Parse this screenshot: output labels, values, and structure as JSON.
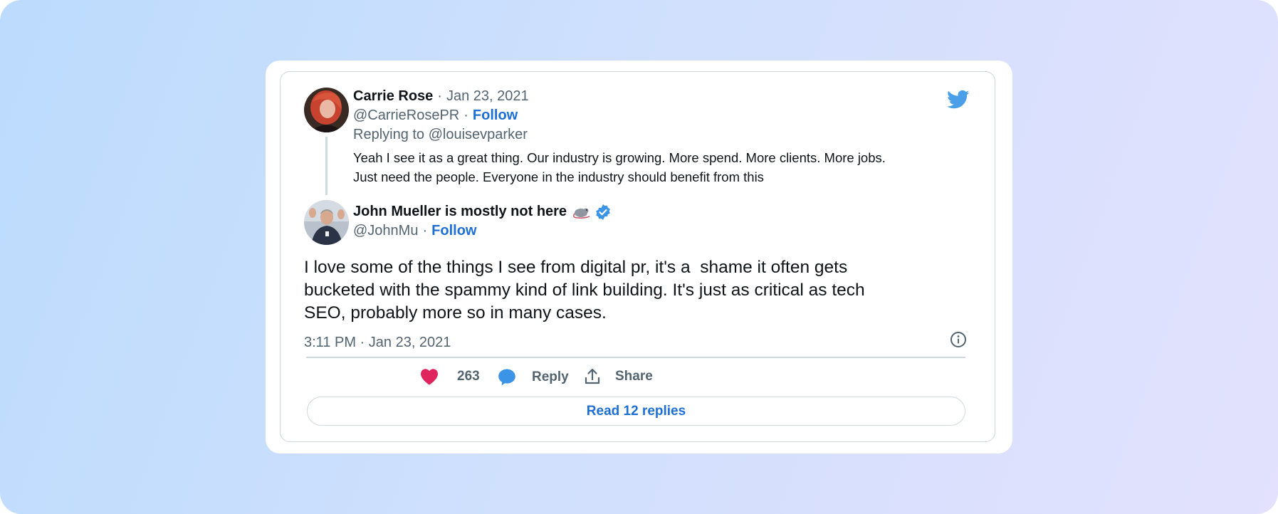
{
  "colors": {
    "accent": "#1d6fd6",
    "like": "#e0245e",
    "reply_bubble": "#3b94e6",
    "twitter_blue": "#4a9fe8",
    "verified": "#3b94e6"
  },
  "reply_tweet": {
    "author_name": "Carrie Rose",
    "date": "Jan 23, 2021",
    "handle": "@CarrieRosePR",
    "follow_label": "Follow",
    "replying_to": "Replying to @louisevparker",
    "text_line1": "Yeah I see it as a great thing. Our industry is growing. More spend. More clients. More jobs.",
    "text_line2": "Just need the people. Everyone in the industry should benefit from this",
    "separator": "·"
  },
  "main_tweet": {
    "author_name": "John Mueller is mostly not here",
    "name_emoji": "rat-icon",
    "verified_icon": "verified-badge-icon",
    "handle": "@JohnMu",
    "follow_label": "Follow",
    "separator": "·",
    "text_line1": "I love some of the things I see from digital pr, it's a  shame it often gets",
    "text_line2": "bucketed with the spammy kind of link building. It's just as critical as tech",
    "text_line3": "SEO, probably more so in many cases.",
    "timestamp": "3:11 PM · Jan 23, 2021"
  },
  "actions": {
    "like_count": "263",
    "reply_label": "Reply",
    "share_label": "Share"
  },
  "read_replies_label": "Read 12 replies"
}
